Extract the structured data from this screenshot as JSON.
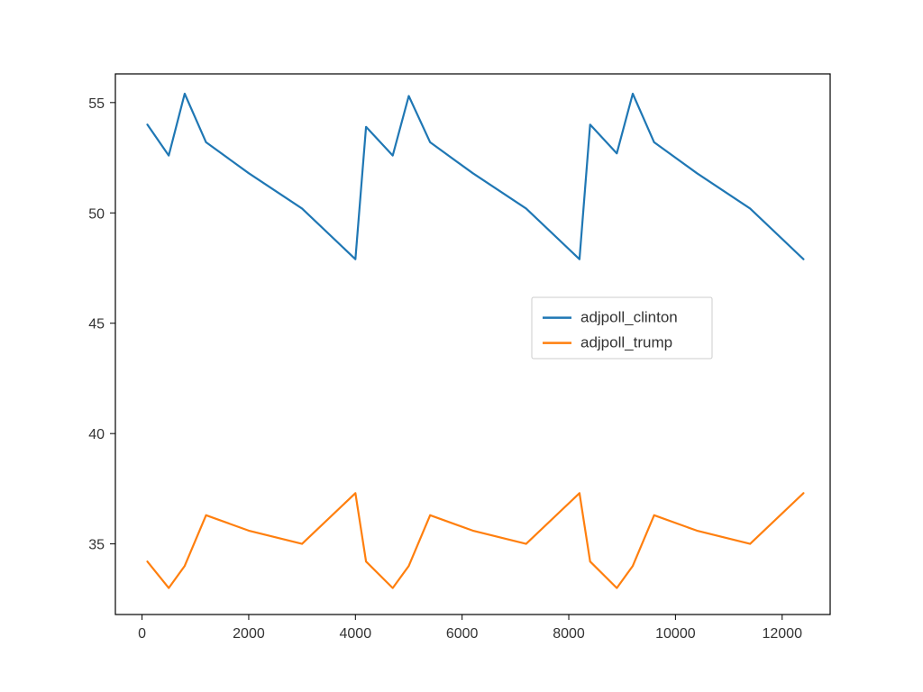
{
  "chart_data": {
    "type": "line",
    "x": [
      100,
      500,
      800,
      1200,
      2000,
      3000,
      4000,
      4200,
      4700,
      5000,
      5400,
      6200,
      7200,
      8200,
      8400,
      8900,
      9200,
      9600,
      10400,
      11400,
      12400
    ],
    "series": [
      {
        "name": "adjpoll_clinton",
        "color": "#1f77b4",
        "values": [
          54.0,
          52.6,
          55.4,
          53.2,
          51.8,
          50.2,
          47.9,
          53.9,
          52.6,
          55.3,
          53.2,
          51.8,
          50.2,
          47.9,
          54.0,
          52.7,
          55.4,
          53.2,
          51.8,
          50.2,
          47.9
        ]
      },
      {
        "name": "adjpoll_trump",
        "color": "#ff7f0e",
        "values": [
          34.2,
          33.0,
          34.0,
          36.3,
          35.6,
          35.0,
          37.3,
          34.2,
          33.0,
          34.0,
          36.3,
          35.6,
          35.0,
          37.3,
          34.2,
          33.0,
          34.0,
          36.3,
          35.6,
          35.0,
          37.3
        ]
      }
    ],
    "xlim": [
      -500,
      12900
    ],
    "ylim": [
      31.8,
      56.3
    ],
    "xticks": [
      0,
      2000,
      4000,
      6000,
      8000,
      10000,
      12000
    ],
    "yticks": [
      35,
      40,
      45,
      50,
      55
    ],
    "title": "",
    "xlabel": "",
    "ylabel": "",
    "legend": {
      "entries": [
        "adjpoll_clinton",
        "adjpoll_trump"
      ],
      "position": "center-right"
    }
  }
}
